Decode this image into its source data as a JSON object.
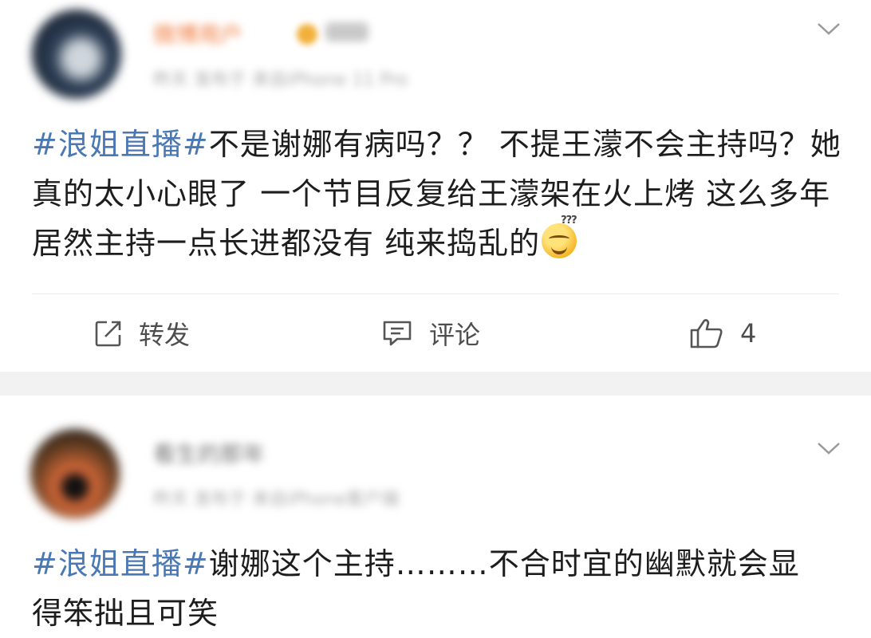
{
  "posts": [
    {
      "username": "微博用户",
      "meta": "昨天 发布于 来自iPhone 11 Pro",
      "tag": "#浪姐直播#",
      "text": "不是谢娜有病吗？？ 不提王濛不会主持吗？她真的太小心眼了 一个节目反复给王濛架在火上烤 这么多年居然主持一点长进都没有 纯来捣乱的",
      "emoji_icon": "sweat-grin-emoji-icon",
      "actions": {
        "repost_label": "转发",
        "comment_label": "评论",
        "like_count": "4"
      }
    },
    {
      "username": "看生的那年",
      "meta": "昨天 发布于 来自iPhone客户端",
      "tag": "#浪姐直播#",
      "text": "谢娜这个主持………不合时宜的幽默就会显得笨拙且可笑"
    }
  ],
  "colors": {
    "hashtag": "#4a78b4",
    "separator": "#f2f2f2",
    "action_text": "#4d4d4d"
  },
  "icons": [
    "share-icon",
    "comment-icon",
    "thumbs-up-icon",
    "chevron-down-icon"
  ]
}
